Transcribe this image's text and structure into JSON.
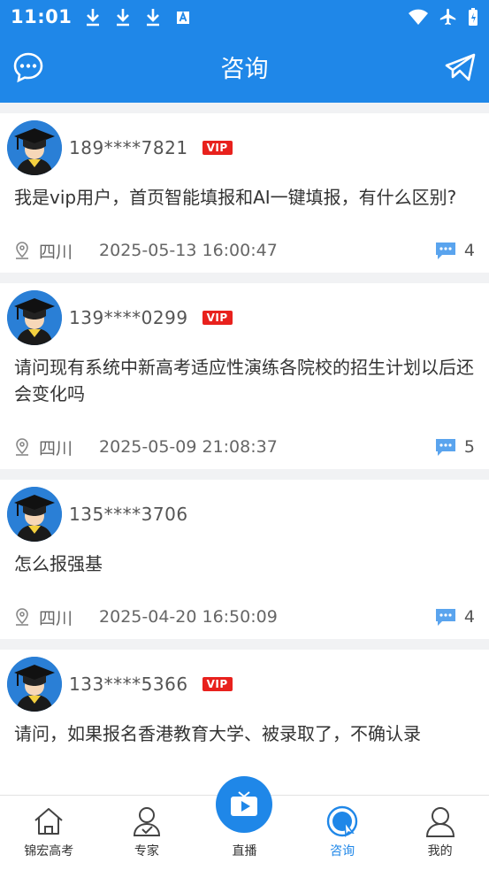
{
  "status": {
    "time": "11:01"
  },
  "appbar": {
    "title": "咨询"
  },
  "posts": [
    {
      "user": "189****7821",
      "vip": "VIP",
      "question": "我是vip用户，首页智能填报和AI一键填报，有什么区别?",
      "location": "四川",
      "time": "2025-05-13 16:00:47",
      "replies": "4"
    },
    {
      "user": "139****0299",
      "vip": "VIP",
      "question": "请问现有系统中新高考适应性演练各院校的招生计划以后还会变化吗",
      "location": "四川",
      "time": "2025-05-09 21:08:37",
      "replies": "5"
    },
    {
      "user": "135****3706",
      "vip": "",
      "question": "怎么报强基",
      "location": "四川",
      "time": "2025-04-20 16:50:09",
      "replies": "4"
    },
    {
      "user": "133****5366",
      "vip": "VIP",
      "question": "请问，如果报名香港教育大学、被录取了，不确认录",
      "location": "",
      "time": "",
      "replies": ""
    }
  ],
  "tabs": [
    {
      "label": "锦宏高考",
      "icon": "home-icon"
    },
    {
      "label": "专家",
      "icon": "expert-icon"
    },
    {
      "label": "直播",
      "icon": "live-tv-icon"
    },
    {
      "label": "咨询",
      "icon": "consult-icon",
      "active": true
    },
    {
      "label": "我的",
      "icon": "profile-icon"
    }
  ],
  "colors": {
    "primary": "#1f87e8",
    "vip": "#e8211d"
  }
}
